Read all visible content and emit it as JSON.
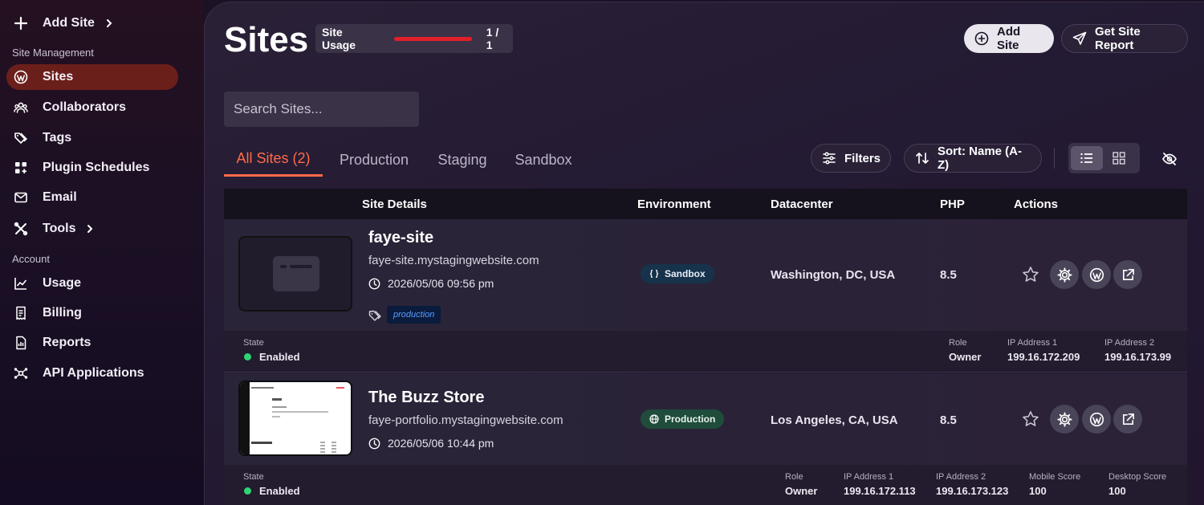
{
  "sidebar": {
    "add_site": "Add Site",
    "section_site_management": "Site Management",
    "section_account": "Account",
    "items": [
      {
        "label": "Sites",
        "icon": "wordpress-icon"
      },
      {
        "label": "Collaborators",
        "icon": "users-icon"
      },
      {
        "label": "Tags",
        "icon": "tags-icon"
      },
      {
        "label": "Plugin Schedules",
        "icon": "grid-plus-icon"
      },
      {
        "label": "Email",
        "icon": "mail-icon"
      },
      {
        "label": "Tools",
        "icon": "tools-icon"
      },
      {
        "label": "Usage",
        "icon": "chart-icon"
      },
      {
        "label": "Billing",
        "icon": "receipt-icon"
      },
      {
        "label": "Reports",
        "icon": "report-icon"
      },
      {
        "label": "API Applications",
        "icon": "api-icon"
      }
    ],
    "active_color": "#6b1f1b"
  },
  "header": {
    "title": "Sites",
    "usage_label": "Site Usage",
    "usage_count": "1 / 1",
    "usage_fraction": 1.0,
    "add_site": "Add Site",
    "get_report": "Get Site Report"
  },
  "search": {
    "placeholder": "Search Sites..."
  },
  "tabs": [
    "All Sites (2)",
    "Production",
    "Staging",
    "Sandbox"
  ],
  "controls": {
    "filters": "Filters",
    "sort": "Sort: Name (A-Z)"
  },
  "table": {
    "headers": [
      "Site Details",
      "Environment",
      "Datacenter",
      "PHP",
      "Actions"
    ],
    "rows": [
      {
        "name": "faye-site",
        "url": "faye-site.mystagingwebsite.com",
        "date": "2026/05/06 09:56 pm",
        "tag": "production",
        "environment": "Sandbox",
        "datacenter": "Washington, DC, USA",
        "php": "8.5",
        "state_label": "State",
        "state": "Enabled",
        "footer": [
          {
            "label": "Role",
            "value": "Owner"
          },
          {
            "label": "IP Address 1",
            "value": "199.16.172.209"
          },
          {
            "label": "IP Address 2",
            "value": "199.16.173.99"
          }
        ]
      },
      {
        "name": "The Buzz Store",
        "url": "faye-portfolio.mystagingwebsite.com",
        "date": "2026/05/06 10:44 pm",
        "environment": "Production",
        "datacenter": "Los Angeles, CA, USA",
        "php": "8.5",
        "state_label": "State",
        "state": "Enabled",
        "footer": [
          {
            "label": "Role",
            "value": "Owner"
          },
          {
            "label": "IP Address 1",
            "value": "199.16.172.113"
          },
          {
            "label": "IP Address 2",
            "value": "199.16.173.123"
          },
          {
            "label": "Mobile Score",
            "value": "100"
          },
          {
            "label": "Desktop Score",
            "value": "100"
          }
        ]
      }
    ]
  },
  "colors": {
    "accent_tab": "#ff6a4a",
    "usage_bar": "#e0202a",
    "enabled_dot": "#2ed573",
    "sandbox_badge": "#17324b",
    "production_badge": "#1f4c3b"
  }
}
